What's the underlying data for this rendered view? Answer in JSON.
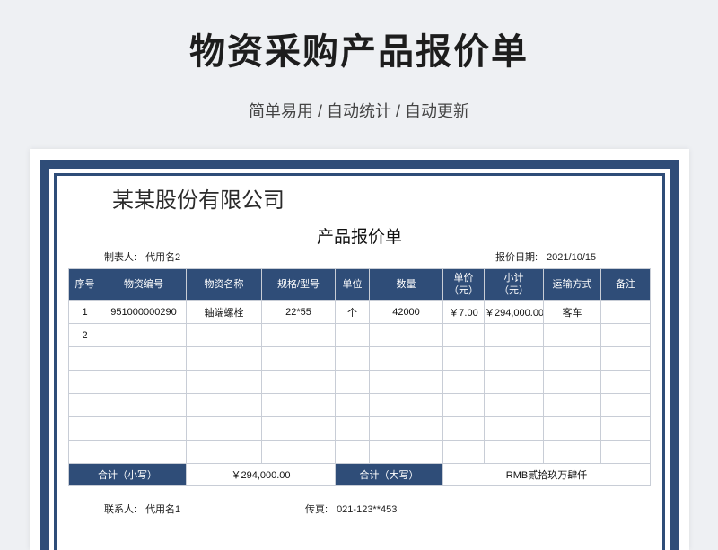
{
  "header": {
    "title": "物资采购产品报价单",
    "subtitle": "简单易用 / 自动统计 / 自动更新"
  },
  "sheet": {
    "company": "某某股份有限公司",
    "doc_title": "产品报价单",
    "maker_label": "制表人:",
    "maker_value": "代用名2",
    "date_label": "报价日期:",
    "date_value": "2021/10/15",
    "columns": [
      "序号",
      "物资编号",
      "物资名称",
      "规格/型号",
      "单位",
      "数量",
      "单价\n（元）",
      "小计\n（元）",
      "运输方式",
      "备注"
    ],
    "rows": [
      [
        "1",
        "951000000290",
        "轴端螺栓",
        "22*55",
        "个",
        "42000",
        "￥7.00",
        "￥294,000.00",
        "客车",
        ""
      ],
      [
        "2",
        "",
        "",
        "",
        "",
        "",
        "",
        "",
        "",
        ""
      ],
      [
        "",
        "",
        "",
        "",
        "",
        "",
        "",
        "",
        "",
        ""
      ],
      [
        "",
        "",
        "",
        "",
        "",
        "",
        "",
        "",
        "",
        ""
      ],
      [
        "",
        "",
        "",
        "",
        "",
        "",
        "",
        "",
        "",
        ""
      ],
      [
        "",
        "",
        "",
        "",
        "",
        "",
        "",
        "",
        "",
        ""
      ],
      [
        "",
        "",
        "",
        "",
        "",
        "",
        "",
        "",
        "",
        ""
      ]
    ],
    "total_small_label": "合计（小写）",
    "total_small_value": "￥294,000.00",
    "total_big_label": "合计（大写）",
    "total_big_value": "RMB贰拾玖万肆仟",
    "contact_label": "联系人:",
    "contact_value": "代用名1",
    "fax_label": "传真:",
    "fax_value": "021-123**453"
  },
  "colors": {
    "accent": "#2f4d78",
    "background": "#eef0f3"
  }
}
